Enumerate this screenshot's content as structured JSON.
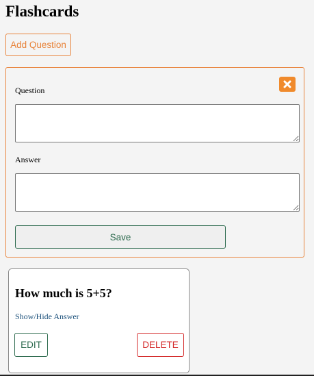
{
  "header": {
    "title": "Flashcards"
  },
  "toolbar": {
    "add_label": "Add Question"
  },
  "form": {
    "question_label": "Question",
    "question_value": "",
    "answer_label": "Answer",
    "answer_value": "",
    "save_label": "Save",
    "close_icon": "close-icon"
  },
  "cards": [
    {
      "question": "How much is 5+5?",
      "toggle_label": "Show/Hide Answer",
      "edit_label": "EDIT",
      "delete_label": "DELETE"
    }
  ],
  "colors": {
    "accent_orange": "#e8833a",
    "primary_green": "#2e6b4f",
    "danger_red": "#d42a2a",
    "link_blue": "#1a4f7a",
    "background": "#f4f4f4"
  }
}
